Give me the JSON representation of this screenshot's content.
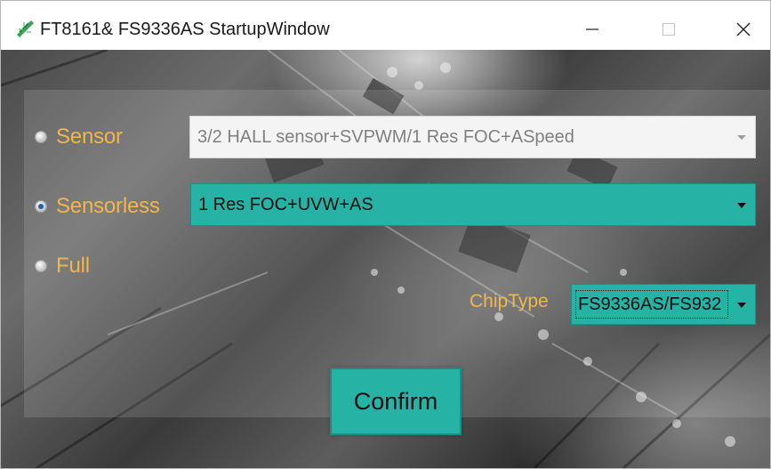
{
  "window": {
    "title": "FT8161& FS9336AS StartupWindow",
    "controls": [
      "minimize",
      "maximize",
      "close"
    ]
  },
  "modes": [
    {
      "label": "Sensor",
      "checked": false
    },
    {
      "label": "Sensorless",
      "checked": true
    },
    {
      "label": "Full",
      "checked": false
    }
  ],
  "sensor_combo": {
    "value": "3/2 HALL sensor+SVPWM/1 Res FOC+ASpeed",
    "enabled": false
  },
  "sensorless_combo": {
    "value": "1 Res FOC+UVW+AS",
    "enabled": true
  },
  "chip": {
    "label": "ChipType",
    "value": "FS9336AS/FS932"
  },
  "confirm": {
    "label": "Confirm"
  },
  "colors": {
    "accent": "#26b3a5",
    "label": "#f2b64a",
    "selected_radio": "#1e62b0"
  },
  "icons": {
    "app": "circuit-board-icon",
    "minimize": "minimize-icon",
    "maximize": "maximize-icon",
    "close": "close-icon",
    "dropdown": "chevron-down-icon"
  }
}
